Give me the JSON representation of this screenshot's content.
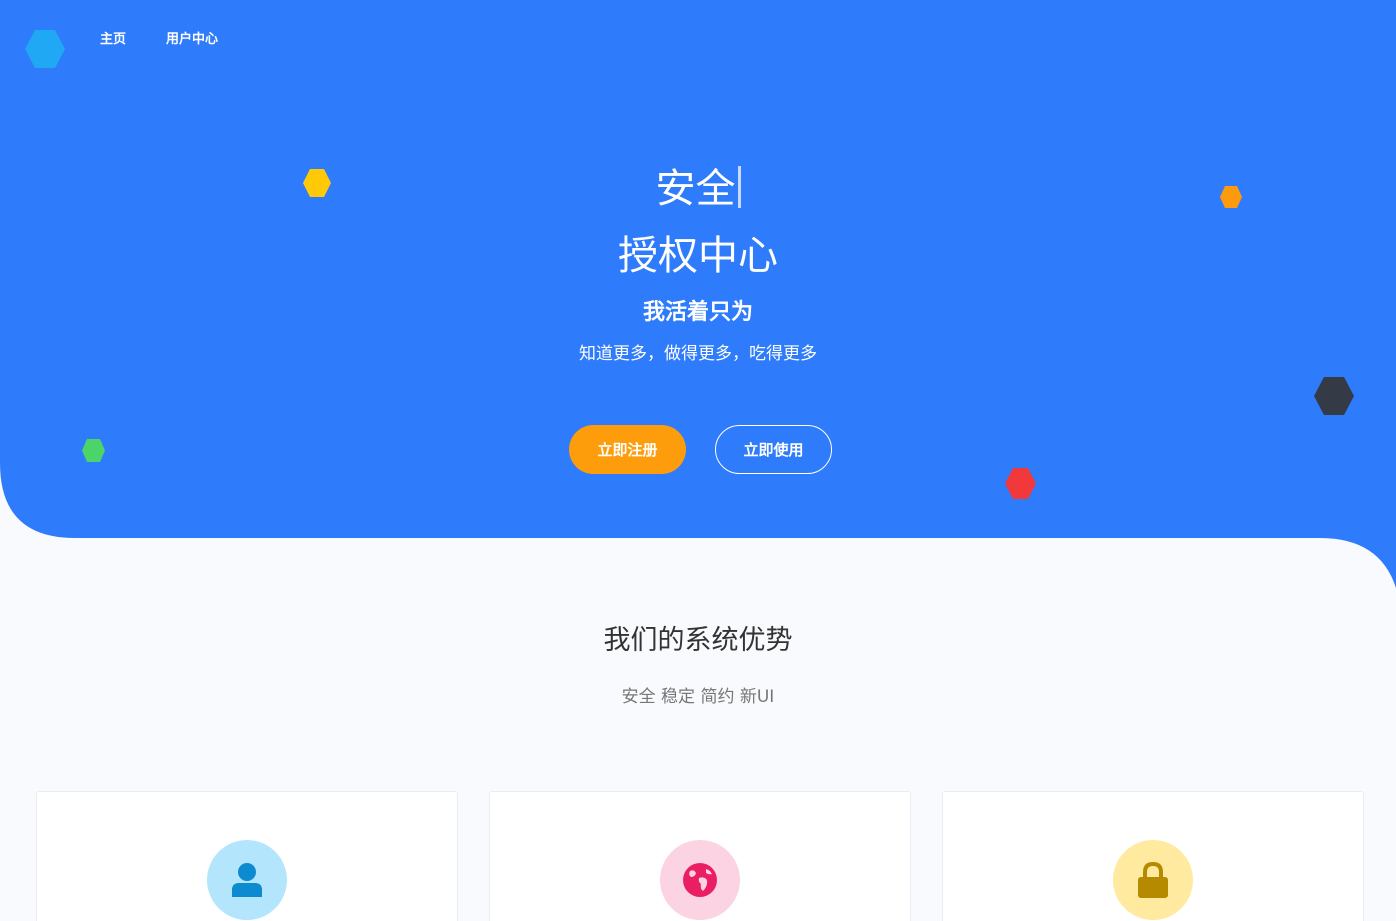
{
  "nav": {
    "home": "主页",
    "user_center": "用户中心"
  },
  "hero": {
    "typed_text": "安全",
    "title": "授权中心",
    "subtitle": "我活着只为",
    "description": "知道更多，做得更多，吃得更多",
    "register_button": "立即注册",
    "use_button": "立即使用"
  },
  "features": {
    "title": "我们的系统优势",
    "subtitle": "安全 稳定 简约 新UI",
    "cards": [
      {
        "icon": "user-icon",
        "icon_bg": "#b3e5fc",
        "icon_color": "#0d8bd1"
      },
      {
        "icon": "globe-icon",
        "icon_bg": "#fbd3e3",
        "icon_color": "#e91e63"
      },
      {
        "icon": "lock-icon",
        "icon_bg": "#ffeaa0",
        "icon_color": "#b58900"
      }
    ]
  },
  "colors": {
    "hero_blue": "#2e7bfb",
    "orange": "#fd9d0c",
    "page_bg": "#f8fafd"
  }
}
